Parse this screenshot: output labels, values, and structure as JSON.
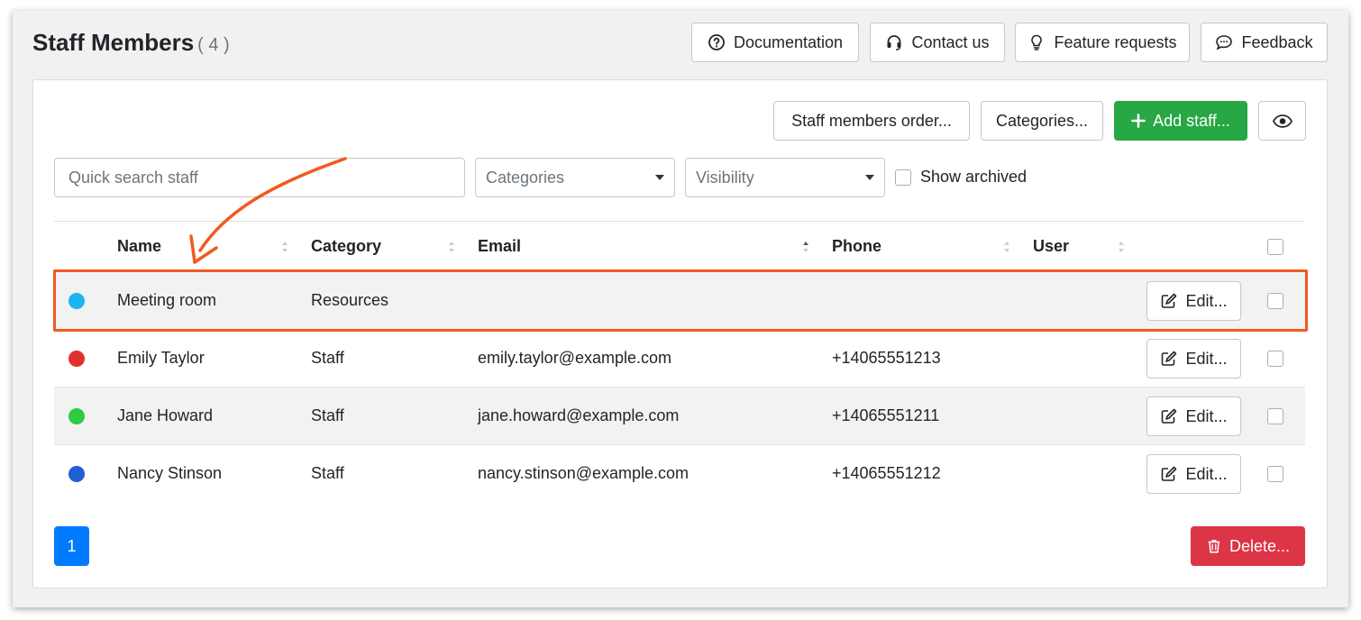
{
  "header": {
    "title": "Staff Members",
    "count": "( 4 )",
    "buttons": {
      "documentation": "Documentation",
      "contact": "Contact us",
      "feature_requests": "Feature requests",
      "feedback": "Feedback"
    }
  },
  "toolbar": {
    "order_label": "Staff members order...",
    "categories_label": "Categories...",
    "add_label": "Add staff...",
    "visibility_icon": "eye-icon"
  },
  "filters": {
    "search_placeholder": "Quick search staff",
    "categories_select": "Categories",
    "visibility_select": "Visibility",
    "show_archived": "Show archived"
  },
  "table": {
    "columns": [
      "Name",
      "Category",
      "Email",
      "Phone",
      "User"
    ],
    "rows": [
      {
        "color": "#1ab5ef",
        "name": "Meeting room",
        "category": "Resources",
        "email": "",
        "phone": "",
        "user": "",
        "edit": "Edit..."
      },
      {
        "color": "#e03131",
        "name": "Emily Taylor",
        "category": "Staff",
        "email": "emily.taylor@example.com",
        "phone": "+14065551213",
        "user": "",
        "edit": "Edit..."
      },
      {
        "color": "#2ecc40",
        "name": "Jane Howard",
        "category": "Staff",
        "email": "jane.howard@example.com",
        "phone": "+14065551211",
        "user": "",
        "edit": "Edit..."
      },
      {
        "color": "#1f5fd1",
        "name": "Nancy Stinson",
        "category": "Staff",
        "email": "nancy.stinson@example.com",
        "phone": "+14065551212",
        "user": "",
        "edit": "Edit..."
      }
    ]
  },
  "pagination": {
    "current_page": "1"
  },
  "actions": {
    "delete_label": "Delete..."
  },
  "colors": {
    "accent_green": "#28a745",
    "primary_blue": "#007bff",
    "danger_red": "#dc3545",
    "highlight_orange": "#f05a1f"
  }
}
